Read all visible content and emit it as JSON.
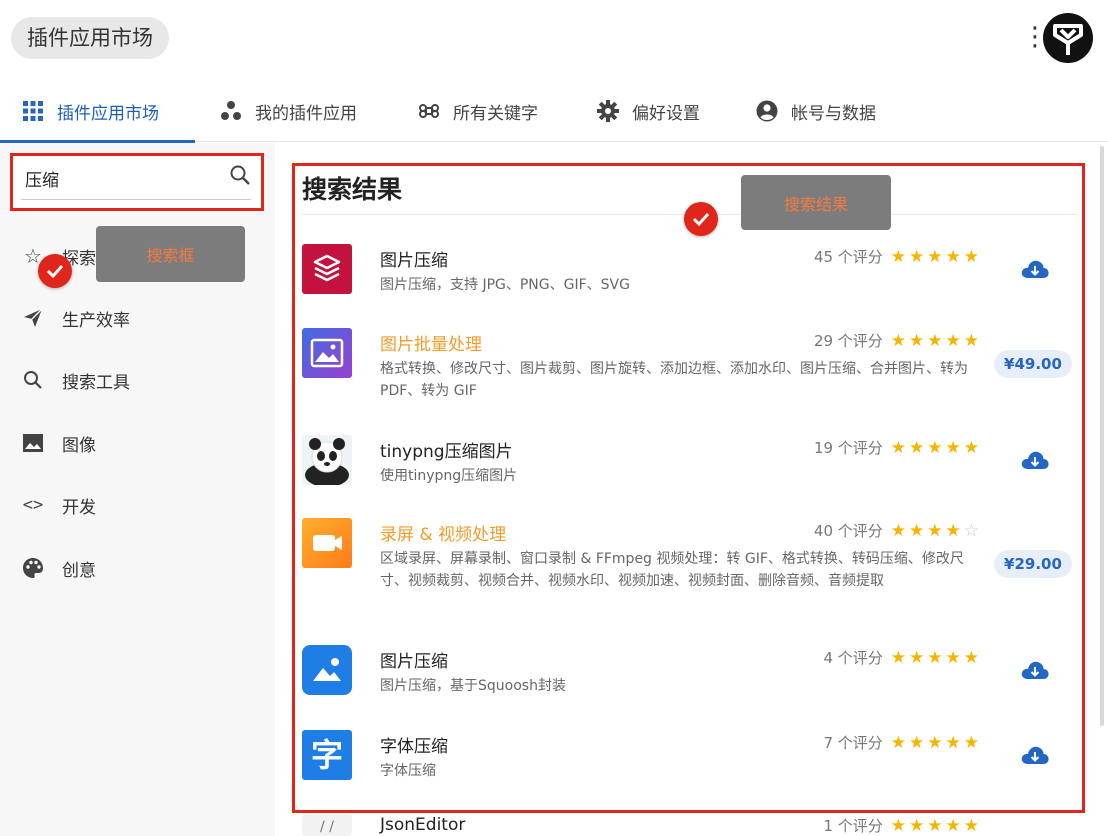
{
  "header": {
    "title": "插件应用市场"
  },
  "tabs": [
    {
      "label": "插件应用市场",
      "icon": "grid-icon",
      "active": true
    },
    {
      "label": "我的插件应用",
      "icon": "apps-dots-icon",
      "active": false
    },
    {
      "label": "所有关键字",
      "icon": "command-icon",
      "active": false
    },
    {
      "label": "偏好设置",
      "icon": "gear-icon",
      "active": false
    },
    {
      "label": "帐号与数据",
      "icon": "account-icon",
      "active": false
    }
  ],
  "sidebar": {
    "search": {
      "value": "压缩"
    },
    "items": [
      {
        "label": "探索",
        "icon": "star-outline-icon"
      },
      {
        "label": "生产效率",
        "icon": "send-icon"
      },
      {
        "label": "搜索工具",
        "icon": "search-icon"
      },
      {
        "label": "图像",
        "icon": "image-icon"
      },
      {
        "label": "开发",
        "icon": "code-icon"
      },
      {
        "label": "创意",
        "icon": "palette-icon"
      }
    ],
    "callout": "搜索框"
  },
  "results": {
    "title": "搜索结果",
    "callout": "搜索结果",
    "items": [
      {
        "name": "图片压缩",
        "desc": "图片压缩，支持 JPG、PNG、GIF、SVG",
        "rating_text": "45 个评分",
        "stars": 5,
        "action": "download",
        "icon": "layers-icon"
      },
      {
        "name": "图片批量处理",
        "desc": "格式转换、修改尺寸、图片裁剪、图片旋转、添加边框、添加水印、图片压缩、合并图片、转为 PDF、转为 GIF",
        "rating_text": "29 个评分",
        "stars": 5,
        "action": "price",
        "price": "¥49.00",
        "icon": "picture-icon"
      },
      {
        "name": "tinypng压缩图片",
        "desc": "使用tinypng压缩图片",
        "rating_text": "19 个评分",
        "stars": 5,
        "action": "download",
        "icon": "panda-icon"
      },
      {
        "name": "录屏 & 视频处理",
        "desc": "区域录屏、屏幕录制、窗口录制 & FFmpeg 视频处理：转 GIF、格式转换、转码压缩、修改尺寸、视频裁剪、视频合并、视频水印、视频加速、视频封面、删除音频、音频提取",
        "rating_text": "40 个评分",
        "stars": 4,
        "action": "price",
        "price": "¥29.00",
        "icon": "video-camera-icon"
      },
      {
        "name": "图片压缩",
        "desc": "图片压缩，基于Squoosh封装",
        "rating_text": "4 个评分",
        "stars": 5,
        "action": "download",
        "icon": "cloud-image-icon"
      },
      {
        "name": "字体压缩",
        "desc": "字体压缩",
        "rating_text": "7 个评分",
        "stars": 5,
        "action": "download",
        "icon": "font-char-icon",
        "glyph": "字"
      },
      {
        "name": "JsonEditor",
        "desc": "",
        "rating_text": "1 个评分",
        "stars": 5,
        "action": "download",
        "icon": "json-icon"
      }
    ]
  },
  "colors": {
    "accent": "#2466c4",
    "highlight_border": "#e0251b",
    "star": "#f7b500",
    "paid_name": "#f29c2a"
  }
}
